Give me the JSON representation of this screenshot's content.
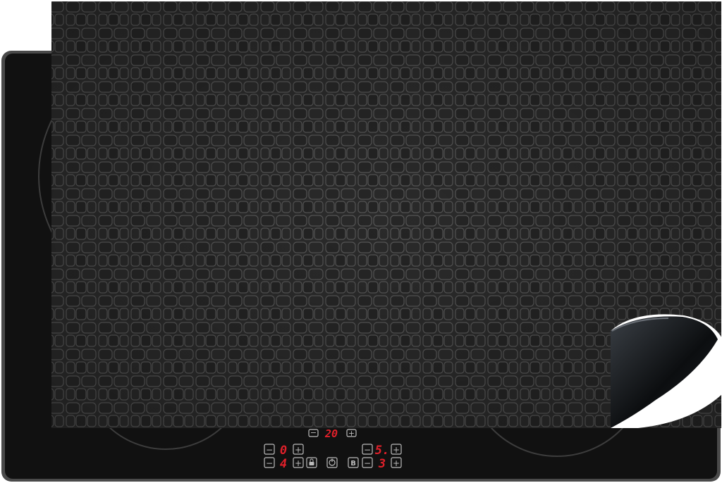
{
  "scene": {
    "description_type": "product-photo",
    "subject": "induction hob protector mat with crocodile leather pattern",
    "colors": {
      "background": "#ffffff",
      "hob_glass": "#111111",
      "hob_frame": "#4a4a4a",
      "mat_base": "#2c2c2c",
      "mat_scale_line": "#5a5a5a",
      "display_red": "#e0202a",
      "control_icon": "#bdbdbd"
    }
  },
  "controls": {
    "timer": {
      "minus": "−",
      "value": "20",
      "plus": "+"
    },
    "zone_left_top": {
      "minus": "−",
      "value": "0",
      "plus": "+"
    },
    "zone_right_top": {
      "minus": "−",
      "value": "5.",
      "plus": "+"
    },
    "zone_left_bottom": {
      "minus": "−",
      "value": "4",
      "plus": "+",
      "lock_icon": "lock-icon"
    },
    "power": {
      "icon": "power-icon"
    },
    "boost": {
      "label": "B"
    },
    "zone_right_bottom": {
      "minus": "−",
      "value": "3",
      "plus": "+"
    }
  }
}
